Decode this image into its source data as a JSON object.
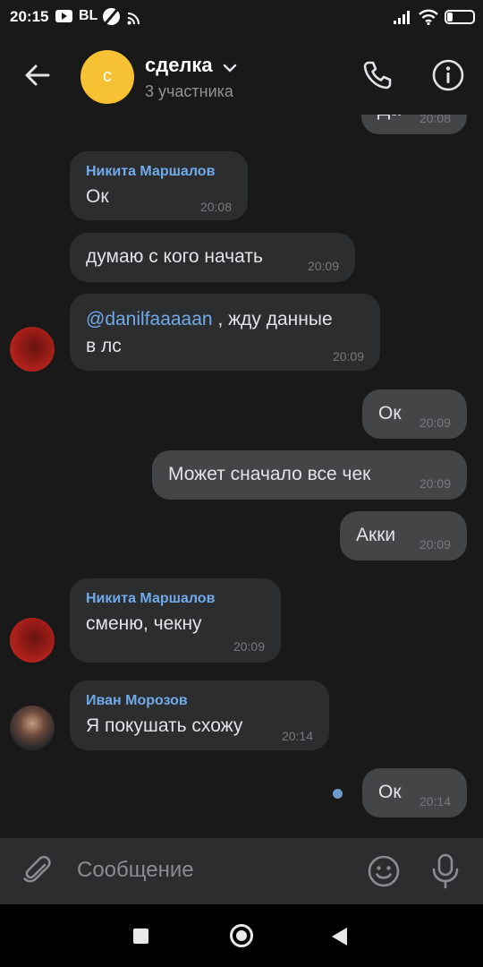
{
  "status_bar": {
    "time": "20:15",
    "carrier_badge": "BL",
    "battery_level": "20"
  },
  "header": {
    "avatar_letter": "с",
    "title": "сделка",
    "subtitle": "3 участника",
    "avatar_color": "#f6c234"
  },
  "messages": [
    {
      "direction": "out",
      "text": "Да",
      "time": "20:08"
    },
    {
      "direction": "in",
      "sender": "Никита Маршалов",
      "text": "Ок",
      "time": "20:08"
    },
    {
      "direction": "in",
      "text": "думаю с кого начать",
      "time": "20:09"
    },
    {
      "direction": "in",
      "mention": "@danilfaaaaan",
      "text_line1": " , жду данные",
      "text_line2": "в лс",
      "time": "20:09"
    },
    {
      "direction": "out",
      "text": "Ок",
      "time": "20:09"
    },
    {
      "direction": "out",
      "text": "Может сначало все чек",
      "time": "20:09"
    },
    {
      "direction": "out",
      "text": "Акки",
      "time": "20:09"
    },
    {
      "direction": "in",
      "sender": "Никита Маршалов",
      "text": "сменю, чекну",
      "time": "20:09"
    },
    {
      "direction": "in",
      "sender": "Иван Морозов",
      "text": "Я покушать схожу",
      "time": "20:14"
    },
    {
      "direction": "out",
      "text": "Ок",
      "time": "20:14"
    }
  ],
  "composer": {
    "placeholder": "Сообщение"
  },
  "colors": {
    "background": "#19191a",
    "incoming_bubble": "#2c2d2e",
    "outgoing_bubble": "#444547",
    "accent": "#71aaeb"
  },
  "icons": [
    "back-arrow-icon",
    "chevron-down-icon",
    "phone-icon",
    "info-icon",
    "attach-icon",
    "emoji-icon",
    "microphone-icon"
  ]
}
